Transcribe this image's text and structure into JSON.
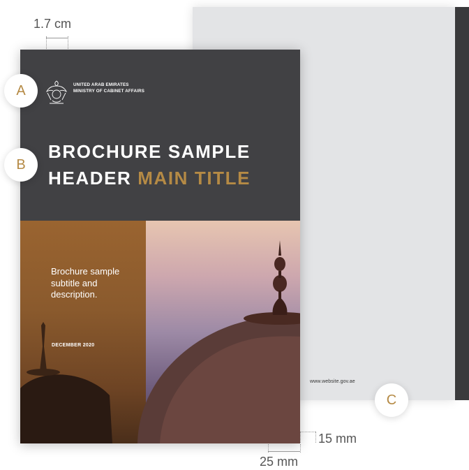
{
  "margin_label": "1.7 cm",
  "callouts": {
    "a": "A",
    "b": "B",
    "c": "C"
  },
  "header": {
    "org_line1": "UNITED ARAB EMIRATES",
    "org_line2": "MINISTRY OF CABINET AFFAIRS",
    "title_line1": "BROCHURE SAMPLE",
    "title_line2_white": "HEADER ",
    "title_line2_accent": "MAIN TITLE"
  },
  "body": {
    "subtitle": "Brochure sample subtitle and description.",
    "date": "DECEMBER 2020"
  },
  "back": {
    "website": "www.website.gov.ae"
  },
  "dimensions": {
    "bottom": "15 mm",
    "side": "25 mm"
  },
  "colors": {
    "accent": "#b58a45",
    "header_bg": "#414144",
    "back_page": "#e3e4e6"
  }
}
